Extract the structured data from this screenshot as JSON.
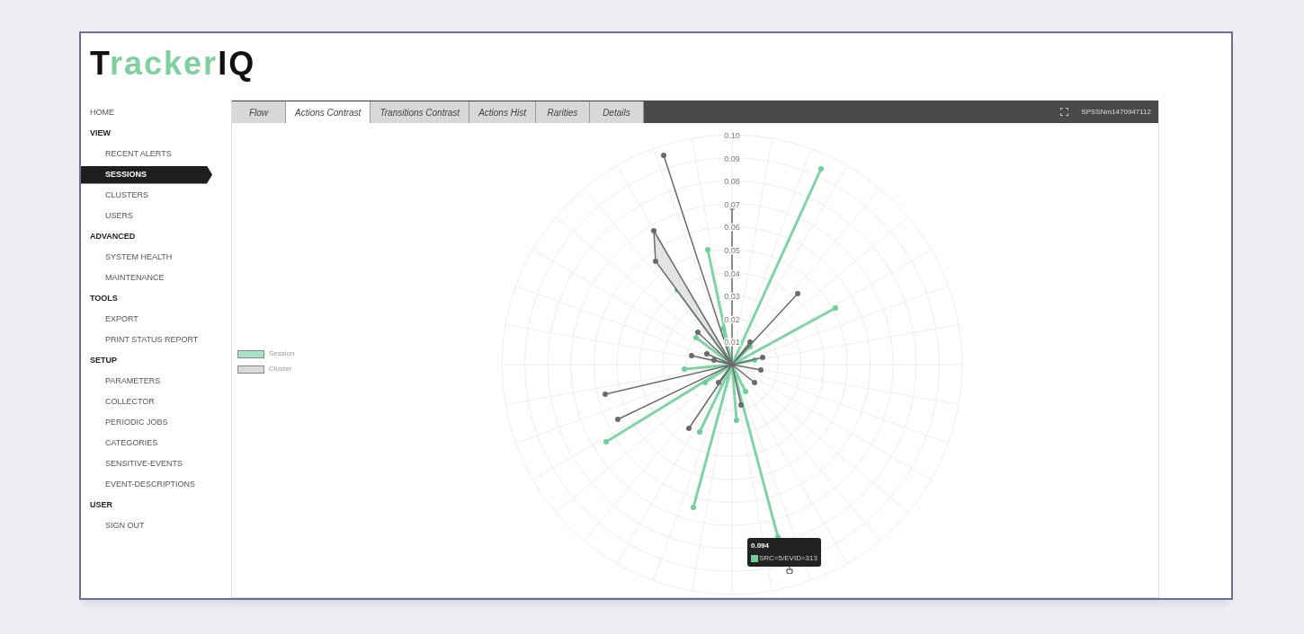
{
  "logo": [
    {
      "text": "T",
      "color": "#111111"
    },
    {
      "text": "racker",
      "color": "#7fcf9f"
    },
    {
      "text": "IQ",
      "color": "#111111"
    }
  ],
  "sidebar": {
    "items": [
      {
        "kind": "link",
        "label": "HOME",
        "selected": false
      },
      {
        "kind": "section",
        "label": "VIEW",
        "children": [
          {
            "label": "RECENT ALERTS",
            "selected": false
          },
          {
            "label": "SESSIONS",
            "selected": true
          },
          {
            "label": "CLUSTERS",
            "selected": false
          },
          {
            "label": "USERS",
            "selected": false
          }
        ]
      },
      {
        "kind": "section",
        "label": "ADVANCED",
        "children": [
          {
            "label": "SYSTEM HEALTH",
            "selected": false
          },
          {
            "label": "MAINTENANCE",
            "selected": false
          }
        ]
      },
      {
        "kind": "section",
        "label": "TOOLS",
        "children": [
          {
            "label": "EXPORT",
            "selected": false
          },
          {
            "label": "PRINT STATUS REPORT",
            "selected": false
          }
        ]
      },
      {
        "kind": "section",
        "label": "SETUP",
        "children": [
          {
            "label": "PARAMETERS",
            "selected": false
          },
          {
            "label": "COLLECTOR",
            "selected": false
          },
          {
            "label": "PERIODIC JOBS",
            "selected": false
          },
          {
            "label": "CATEGORIES",
            "selected": false
          },
          {
            "label": "SENSITIVE-EVENTS",
            "selected": false
          },
          {
            "label": "EVENT-DESCRIPTIONS",
            "selected": false
          }
        ]
      },
      {
        "kind": "section",
        "label": "USER",
        "children": [
          {
            "label": "SIGN OUT",
            "selected": false
          }
        ]
      }
    ]
  },
  "tabs": [
    {
      "label": "Flow",
      "selected": false
    },
    {
      "label": "Actions Contrast",
      "selected": true
    },
    {
      "label": "Transitions Contrast",
      "selected": false
    },
    {
      "label": "Actions Hist",
      "selected": false
    },
    {
      "label": "Rarities",
      "selected": false
    },
    {
      "label": "Details",
      "selected": false
    }
  ],
  "session_id": "SPSSNm1470947112",
  "legend": [
    {
      "label": "Session",
      "color": "#a8e3c4"
    },
    {
      "label": "Cluster",
      "color": "#d9d9d9"
    }
  ],
  "radial_ticks": [
    "0.10",
    "0.09",
    "0.08",
    "0.07",
    "0.06",
    "0.05",
    "0.04",
    "0.03",
    "0.02",
    "0.01"
  ],
  "tooltip": {
    "value": "0.094",
    "label": "SRC=5/EVID=313",
    "color": "#6fcf97"
  }
}
